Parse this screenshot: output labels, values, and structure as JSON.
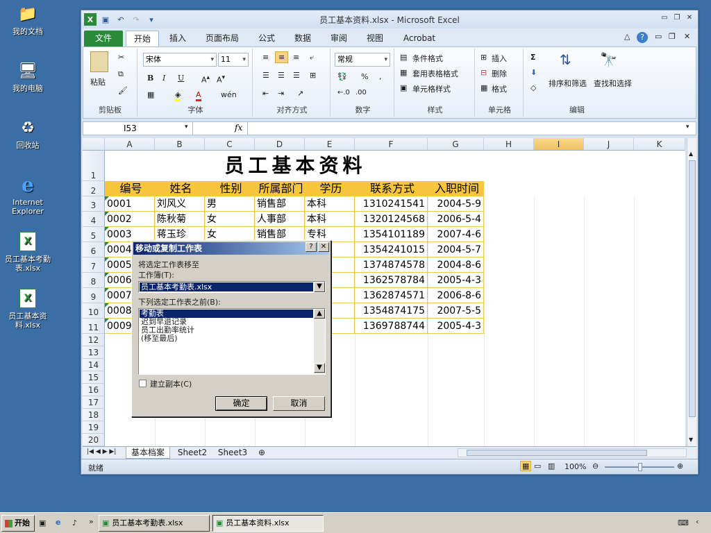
{
  "desktop": {
    "icons": [
      {
        "label": "我的文档",
        "icon": "folder-documents-icon"
      },
      {
        "label": "我的电脑",
        "icon": "computer-icon"
      },
      {
        "label": "回收站",
        "icon": "recycle-bin-icon"
      },
      {
        "label": "Internet Explorer",
        "icon": "internet-explorer-icon"
      },
      {
        "label": "员工基本考勤表.xlsx",
        "icon": "excel-file-icon"
      },
      {
        "label": "员工基本资料.xlsx",
        "icon": "excel-file-icon"
      }
    ]
  },
  "window": {
    "title": "员工基本资料.xlsx - Microsoft Excel",
    "tabs": [
      "文件",
      "开始",
      "插入",
      "页面布局",
      "公式",
      "数据",
      "审阅",
      "视图",
      "Acrobat"
    ],
    "active_tab": "开始"
  },
  "ribbon": {
    "clipboard": {
      "paste": "粘贴",
      "label": "剪贴板"
    },
    "font": {
      "name": "宋体",
      "size": "11",
      "label": "字体"
    },
    "alignment": {
      "label": "对齐方式"
    },
    "number": {
      "format": "常规",
      "label": "数字"
    },
    "styles": {
      "conditional": "条件格式",
      "table": "套用表格格式",
      "cell": "单元格样式",
      "label": "样式"
    },
    "cells": {
      "insert": "插入",
      "delete": "删除",
      "format": "格式",
      "label": "单元格"
    },
    "editing": {
      "sort": "排序和筛选",
      "find": "查找和选择",
      "label": "编辑"
    }
  },
  "formula_bar": {
    "name_box": "I53",
    "fx": "fx",
    "formula": ""
  },
  "sheet": {
    "columns": [
      "A",
      "B",
      "C",
      "D",
      "E",
      "F",
      "G",
      "H",
      "I",
      "J",
      "K"
    ],
    "rows": [
      "1",
      "2",
      "3",
      "4",
      "5",
      "6",
      "7",
      "8",
      "9",
      "10",
      "11",
      "12",
      "13",
      "14",
      "15",
      "16",
      "17",
      "18",
      "19",
      "20"
    ],
    "title": "员工基本资料",
    "headers": [
      "编号",
      "姓名",
      "性别",
      "所属部门",
      "学历",
      "联系方式",
      "入职时间"
    ],
    "data": [
      [
        "0001",
        "刘风义",
        "男",
        "销售部",
        "本科",
        "1310241541",
        "2004-5-9"
      ],
      [
        "0002",
        "陈秋菊",
        "女",
        "人事部",
        "本科",
        "1320124568",
        "2006-5-4"
      ],
      [
        "0003",
        "蒋玉珍",
        "女",
        "销售部",
        "专科",
        "1354101189",
        "2007-4-6"
      ],
      [
        "0004",
        "",
        "",
        "",
        "",
        "1354241015",
        "2004-5-7"
      ],
      [
        "0005",
        "",
        "",
        "",
        "",
        "1374874578",
        "2004-8-6"
      ],
      [
        "0006",
        "",
        "",
        "",
        "",
        "1362578784",
        "2005-4-3"
      ],
      [
        "0007",
        "",
        "",
        "",
        "生",
        "1362874571",
        "2006-8-6"
      ],
      [
        "0008",
        "",
        "",
        "",
        "生",
        "1354874175",
        "2007-5-5"
      ],
      [
        "0009",
        "",
        "",
        "",
        "生",
        "1369788744",
        "2005-4-3"
      ]
    ],
    "sheet_tabs": [
      "基本档案",
      "Sheet2",
      "Sheet3"
    ]
  },
  "status": {
    "ready": "就绪",
    "zoom": "100%"
  },
  "dialog": {
    "title": "移动或复制工作表",
    "move_to": "将选定工作表移至",
    "workbook_label": "工作簿(T):",
    "workbook_value": "员工基本考勤表.xlsx",
    "before_label": "下列选定工作表之前(B):",
    "sheets": [
      "考勤表",
      "迟到早退记录",
      "员工出勤率统计",
      "(移至最后)"
    ],
    "selected_index": 0,
    "copy_label": "建立副本(C)",
    "ok": "确定",
    "cancel": "取消"
  },
  "taskbar": {
    "start": "开始",
    "tasks": [
      "员工基本考勤表.xlsx",
      "员工基本资料.xlsx"
    ]
  },
  "colors": {
    "header_fill": "#f7c63c",
    "accent": "#2a8a3a",
    "selection": "#0a246a",
    "desktop": "#3a6ea5"
  }
}
